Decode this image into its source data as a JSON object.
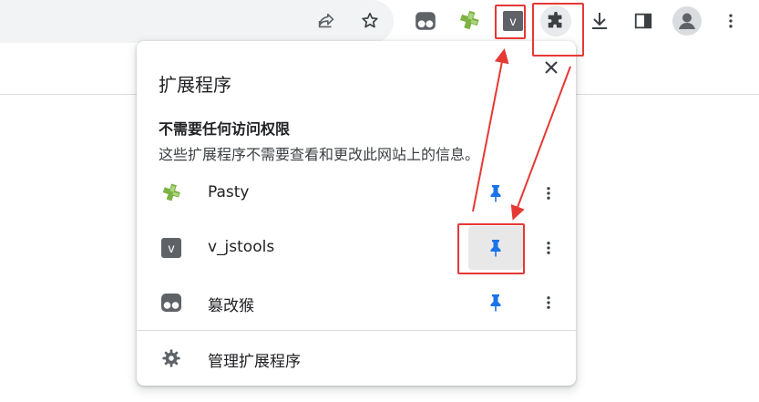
{
  "toolbar": {
    "icons": [
      "share-icon",
      "bookmark-star-icon",
      "tampermonkey-icon",
      "pasty-icon",
      "v-jstools-icon",
      "extensions-puzzle-icon",
      "download-icon",
      "side-panel-icon",
      "profile-avatar-icon",
      "menu-more-icon"
    ],
    "v_badge": "v"
  },
  "popup": {
    "title": "扩展程序",
    "section_title": "不需要任何访问权限",
    "section_desc": "这些扩展程序不需要查看和更改此网站上的信息。",
    "extensions": [
      {
        "name": "Pasty",
        "icon": "pasty-icon",
        "pinned": true
      },
      {
        "name": "v_jstools",
        "icon": "v-jstools-icon",
        "icon_letter": "v",
        "pinned": true
      },
      {
        "name": "篡改猴",
        "icon": "tampermonkey-icon",
        "pinned": true
      }
    ],
    "manage_label": "管理扩展程序"
  },
  "colors": {
    "pin_blue": "#1a73e8",
    "annotation_red": "#e53935",
    "icon_grey": "#5f6368"
  }
}
